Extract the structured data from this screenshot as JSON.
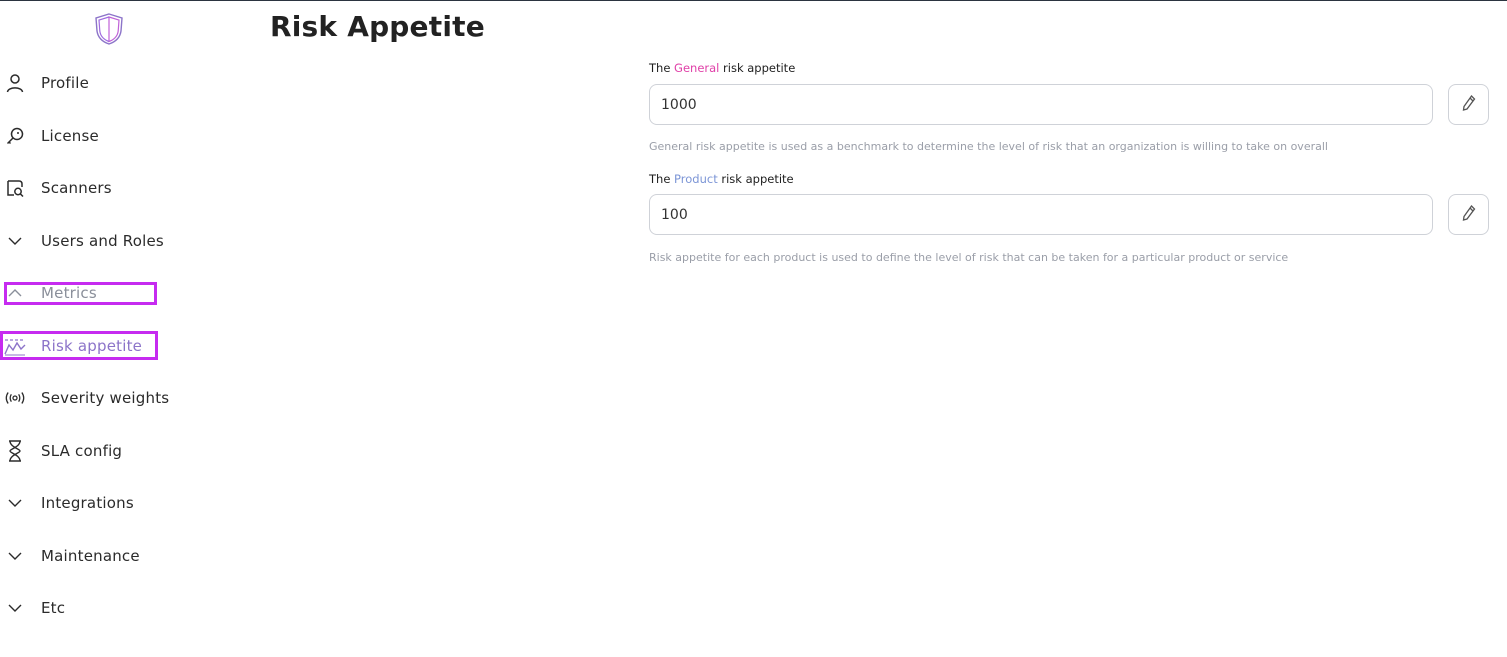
{
  "sidebar": {
    "items": [
      {
        "label": "Profile",
        "icon": "user-icon"
      },
      {
        "label": "License",
        "icon": "key-icon"
      },
      {
        "label": "Scanners",
        "icon": "scanner-search-icon"
      },
      {
        "label": "Users and Roles",
        "icon": "chevron-down-icon"
      },
      {
        "label": "Metrics",
        "icon": "chevron-up-icon"
      },
      {
        "label": "Risk appetite",
        "icon": "chart-line-icon"
      },
      {
        "label": "Severity weights",
        "icon": "broadcast-icon"
      },
      {
        "label": "SLA config",
        "icon": "hourglass-icon"
      },
      {
        "label": "Integrations",
        "icon": "chevron-down-icon"
      },
      {
        "label": "Maintenance",
        "icon": "chevron-down-icon"
      },
      {
        "label": "Etc",
        "icon": "chevron-down-icon"
      }
    ]
  },
  "main": {
    "title": "Risk Appetite",
    "general": {
      "label_prefix": "The ",
      "label_highlight": "General",
      "label_suffix": " risk appetite",
      "value": "1000",
      "help": "General risk appetite is used as a benchmark to determine the level of risk that an organization is willing to take on overall"
    },
    "product": {
      "label_prefix": "The ",
      "label_highlight": "Product",
      "label_suffix": " risk appetite",
      "value": "100",
      "help": "Risk appetite for each product is used to define the level of risk that can be taken for a particular product or service"
    }
  },
  "colors": {
    "general_highlight": "#e040a8",
    "product_highlight": "#7c95d6",
    "active_nav": "#8c74c9",
    "selection_box": "#c62bf0"
  }
}
